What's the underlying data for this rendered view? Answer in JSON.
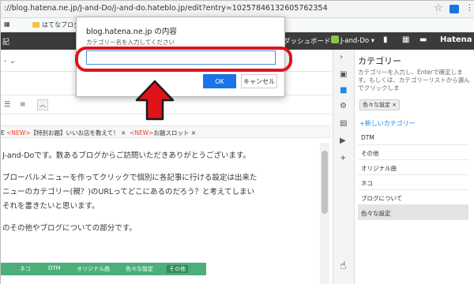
{
  "browser": {
    "url": "://blog.hatena.ne.jp/J-and-Do/j-and-do.hateblo.jp/edit?entry=10257846132605762354",
    "bookmarks": [
      "はてなブログ"
    ]
  },
  "hatena_nav": {
    "left_label": "記",
    "dashboard_label": "ダッシュボード",
    "user_label": "J-and-Do",
    "brand": "Hatena"
  },
  "editor": {
    "title_partial": "-",
    "tags_line": {
      "prefix": "E",
      "new1": "<NEW>",
      "tag1": "【特別お題】いいお店を教えて！",
      "new2": "<NEW>",
      "tag2": "お題スロット"
    },
    "body": [
      "J-and-Doです。数あるブログからご訪問いただきありがとうございます。",
      "",
      "ブローバルメニューを作ってクリックで個別に各記事に行ける設定は出来た",
      "ニューのカテゴリー(親？)のURLってどこにあるのだろう？と考えてしまい",
      "それを書きたいと思います。",
      "",
      "のその他やブログについての部分です。"
    ],
    "green_nav": [
      "ネコ",
      "DTM",
      "オリジナル曲",
      "色々な設定",
      "その他"
    ]
  },
  "category_panel": {
    "heading": "カテゴリー",
    "description": "カテゴリーを入力し、Enterで確定します。もしくは、カテゴリーリストから選んでクリックしま",
    "chip": "色々な設定",
    "new_category": "新しいカテゴリー",
    "items": [
      "DTM",
      "その他",
      "オリジナル曲",
      "ネコ",
      "ブログについて",
      "色々な設定"
    ],
    "selected": "色々な設定"
  },
  "dialog": {
    "title": "blog.hatena.ne.jp の内容",
    "message": "カテゴリー名を入力してください",
    "input_value": "",
    "ok_label": "OK",
    "cancel_label": "キャンセル"
  },
  "colors": {
    "annotation": "#e0121a",
    "accent": "#1a73e8",
    "nav_bg": "#3b3b3b",
    "green_nav": "#4caf7a"
  }
}
